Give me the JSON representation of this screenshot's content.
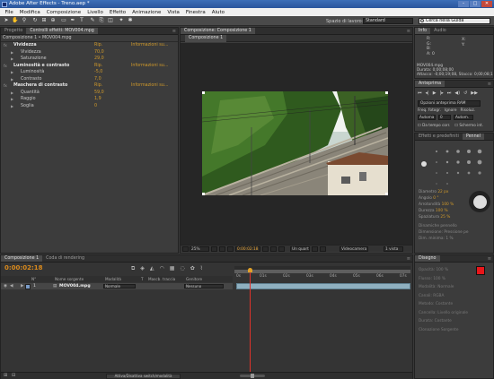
{
  "window": {
    "title": "Adobe After Effects - Treno.aep *",
    "buttons": [
      "–",
      "□",
      "✕"
    ]
  },
  "menu": [
    "File",
    "Modifica",
    "Composizione",
    "Livello",
    "Effetto",
    "Animazione",
    "Vista",
    "Finestra",
    "Aiuto"
  ],
  "toolbar": {
    "workspace_label": "Spazio di lavoro:",
    "workspace_value": "Standard",
    "search_placeholder": "Cerca nella Guida"
  },
  "effects_panel": {
    "tabs": [
      "Progetto",
      "Controlli effetti: MOV004.mpg"
    ],
    "breadcrumb": "Composizione 1 • MOV004.mpg",
    "rows": [
      {
        "name": "Vividezza",
        "val": "Rip.",
        "info": "Informazioni su...",
        "header": true
      },
      {
        "name": "Vividezza",
        "val": "70,0",
        "info": "",
        "header": false
      },
      {
        "name": "Saturazione",
        "val": "29,0",
        "info": "",
        "header": false
      },
      {
        "name": "Luminosità e contrasto",
        "val": "Rip.",
        "info": "Informazioni su...",
        "header": true
      },
      {
        "name": "Luminosità",
        "val": "-5,0",
        "info": "",
        "header": false
      },
      {
        "name": "Contrasto",
        "val": "7,0",
        "info": "",
        "header": false
      },
      {
        "name": "Maschera di contrasto",
        "val": "Rip.",
        "info": "Informazioni su...",
        "header": true
      },
      {
        "name": "Quantità",
        "val": "59,0",
        "info": "",
        "header": false
      },
      {
        "name": "Raggio",
        "val": "1,9",
        "info": "",
        "header": false
      },
      {
        "name": "Soglia",
        "val": "0",
        "info": "",
        "header": false
      }
    ]
  },
  "comp_panel": {
    "tab": "Composizione: Composizione 1",
    "subtab": "Composizione 1",
    "zoom": "25%",
    "timecode": "0:00:02:18",
    "resolution": "Un quart",
    "camera": "Videocamera",
    "views": "1 vista"
  },
  "info_panel": {
    "tabs": [
      "Info",
      "Audio"
    ],
    "rgb": [
      "R:",
      "G:",
      "B:",
      "A: 0"
    ],
    "xy": [
      "X:",
      "Y:"
    ],
    "file": "MOV004.mpg",
    "duration": "Durata: 0;00;08;00",
    "attack": "Attacco: -0;00;19;08, Stacco: 0;00;08;1"
  },
  "preview_panel": {
    "tab": "Anteprima",
    "options_label": "Opzioni anteprima RAM",
    "fps_label": "Freq. fotogr.",
    "skip_label": "Ignore",
    "res_label": "Risoluz.",
    "fps_value": "Automa",
    "skip_value": "0",
    "res_value": "Autom.",
    "from_current": "Da tempo corr.",
    "fullscreen": "Schermo int."
  },
  "effects_presets": {
    "tabs": [
      "Effetti e predefiniti",
      "Pennel"
    ]
  },
  "brush_props": {
    "labels": [
      "Diametro",
      "Angolo",
      "Arrotondità",
      "Durezza",
      "Spaziatura"
    ],
    "values": [
      "22 px",
      "0 °",
      "100 %",
      "100 %",
      "25 %"
    ],
    "dynamics": "Dinamiche pennello",
    "size": "Dimensione:",
    "size_value": "Pressione pe",
    "min_size": "Dim. minima:",
    "min_size_value": "1 %"
  },
  "timeline": {
    "tabs": [
      "Composizione 1",
      "Coda di rendering"
    ],
    "timecode": "0:00:02:18",
    "columns": [
      "N°",
      "Nome sorgente",
      "Modalità",
      "T",
      "Mascb. traccia",
      "Genitore"
    ],
    "layer": {
      "num": "1",
      "name": "MOV004.mpg",
      "mode": "Normale",
      "parent": "Nessuno"
    },
    "ruler": [
      "0s",
      "01s",
      "02s",
      "03s",
      "04s",
      "05s",
      "06s",
      "07s"
    ],
    "footer": "Attiva/Disattiva switch/modalità"
  },
  "paint_panel": {
    "tab": "Disegno",
    "labels": [
      "Opacità:",
      "Flusso:",
      "Modalità:",
      "Canali:",
      "Metodo:",
      "Cancella:",
      "Durata:",
      "Clonazione"
    ],
    "values": [
      "100 %",
      "100 %",
      "Normale",
      "RGBA",
      "Costante",
      "Livello originale",
      "Costante",
      "Sorgente"
    ],
    "colors": {
      "fg": "#e8161a",
      "bg": "#ffffff"
    }
  }
}
